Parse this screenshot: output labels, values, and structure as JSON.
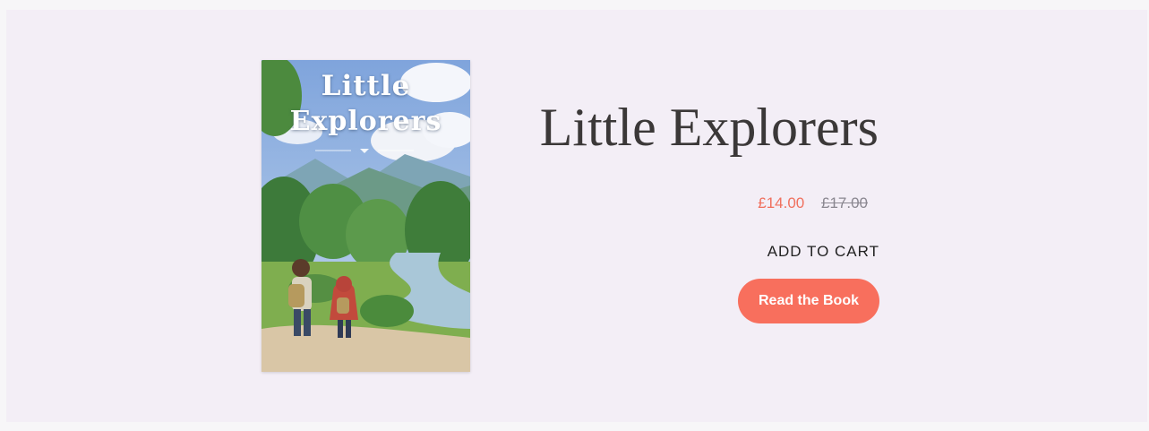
{
  "product": {
    "cover_title_line1": "Little",
    "cover_title_line2": "Explorers",
    "title": "Little Explorers",
    "sale_price": "£14.00",
    "original_price": "£17.00",
    "add_to_cart_label": "ADD TO CART",
    "read_button_label": "Read the Book"
  },
  "colors": {
    "background": "#f3eef6",
    "accent": "#f86f5d",
    "sale_price": "#f0705e",
    "original_price": "#8a8790",
    "title": "#3b3838"
  },
  "icons": [
    "book-cover-illustration"
  ]
}
